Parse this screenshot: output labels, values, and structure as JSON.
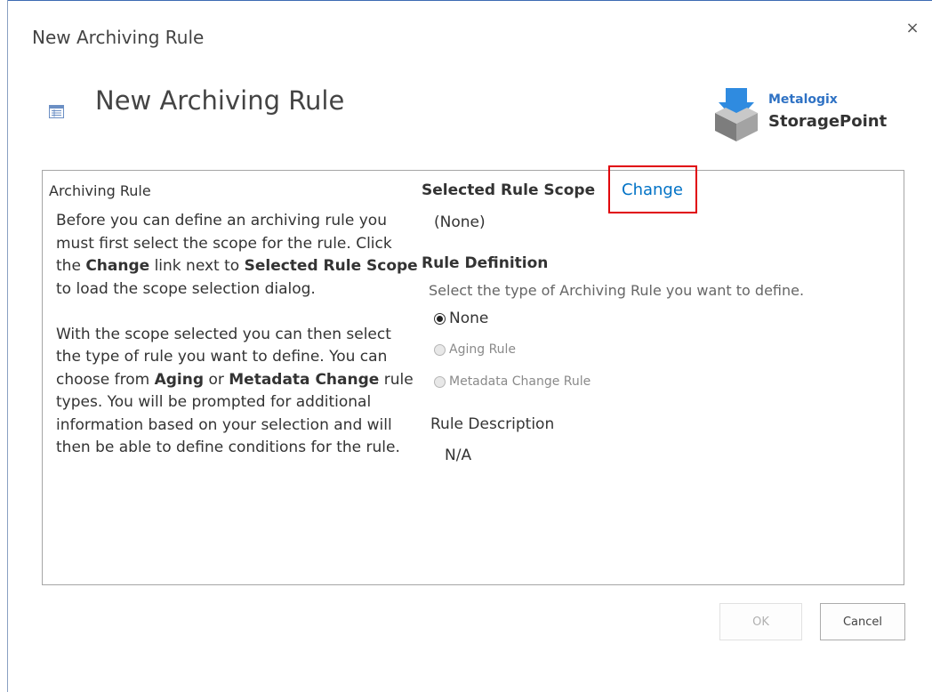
{
  "dialog": {
    "title": "New Archiving Rule",
    "close_label": "×"
  },
  "header": {
    "page_title": "New Archiving Rule",
    "logo": {
      "line1": "Metalogix",
      "line2": "StoragePoint"
    }
  },
  "left_pane": {
    "section_label": "Archiving Rule",
    "paragraph1": {
      "t1": "Before you can define an archiving rule you must first select the scope for the rule. Click the ",
      "b1": "Change",
      "t2": " link next to ",
      "b2": "Selected Rule Scope",
      "t3": " to load the scope selection dialog."
    },
    "paragraph2": {
      "t1": "With the scope selected you can then select the type of rule you want to define. You can choose from ",
      "b1": "Aging",
      "t2": " or ",
      "b2": "Metadata Change",
      "t3": " rule types. You will be prompted for additional information based on your selection and will then be able to define conditions for the rule."
    }
  },
  "right_pane": {
    "scope_heading": "Selected Rule Scope",
    "change_link": "Change",
    "scope_value": "(None)",
    "rule_definition_heading": "Rule Definition",
    "rule_definition_hint": "Select the type of Archiving Rule you want to define.",
    "rule_types": [
      {
        "label": "None",
        "selected": true,
        "enabled": true
      },
      {
        "label": "Aging Rule",
        "selected": false,
        "enabled": false
      },
      {
        "label": "Metadata Change Rule",
        "selected": false,
        "enabled": false
      }
    ],
    "description_heading": "Rule Description",
    "description_value": "N/A"
  },
  "footer": {
    "ok_label": "OK",
    "cancel_label": "Cancel"
  },
  "colors": {
    "link": "#0072c6",
    "highlight": "#e0000a",
    "logo_blue": "#2f72c4"
  },
  "icons": [
    "page-list-icon",
    "close-icon",
    "storagepoint-logo-icon"
  ]
}
